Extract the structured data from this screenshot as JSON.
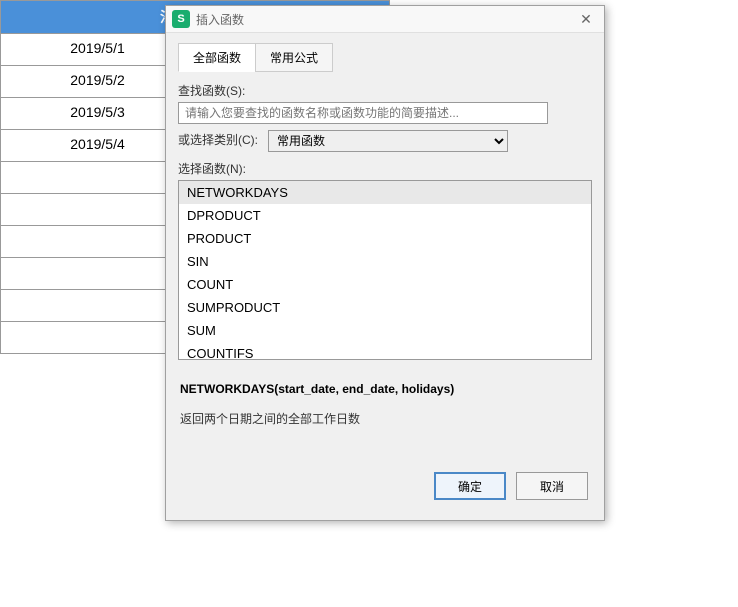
{
  "spreadsheet": {
    "header": "法定节假日",
    "rows": [
      "2019/5/1",
      "2019/5/2",
      "2019/5/3",
      "2019/5/4",
      "",
      "",
      "",
      "",
      "",
      ""
    ]
  },
  "dialog": {
    "title": "插入函数",
    "app_icon_text": "S",
    "tabs": {
      "all": "全部函数",
      "common": "常用公式"
    },
    "search_label": "查找函数(S):",
    "search_placeholder": "请输入您要查找的函数名称或函数功能的简要描述...",
    "category_label": "或选择类别(C):",
    "category_value": "常用函数",
    "select_label": "选择函数(N):",
    "functions": [
      "NETWORKDAYS",
      "DPRODUCT",
      "PRODUCT",
      "SIN",
      "COUNT",
      "SUMPRODUCT",
      "SUM",
      "COUNTIFS"
    ],
    "signature": "NETWORKDAYS(start_date, end_date, holidays)",
    "description": "返回两个日期之间的全部工作日数",
    "ok_btn": "确定",
    "cancel_btn": "取消"
  }
}
